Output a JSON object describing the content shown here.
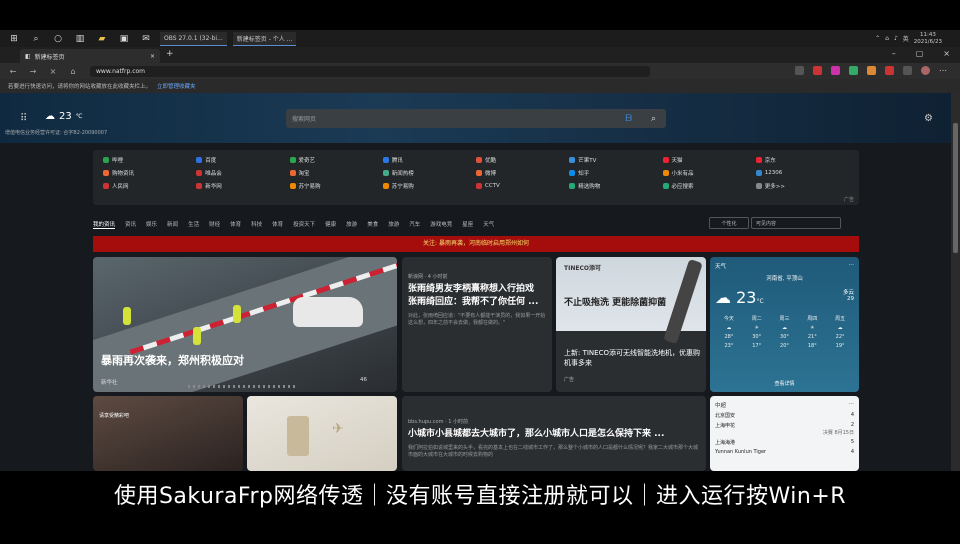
{
  "taskbar": {
    "obs_app": "OBS 27.0.1 (32-bi...",
    "edge_app": "新建标签页 - 个人 ...",
    "lang": "英",
    "time": "11:43",
    "date": "2021/6/23"
  },
  "browser": {
    "tab_title": "新建标签页",
    "url": "www.natfrp.com",
    "infobar_text": "若要进行快速访问，请将你的网站收藏放在此收藏夹栏上。",
    "infobar_link": "立即管理收藏夹"
  },
  "page": {
    "temp": "23",
    "temp_unit": "℃",
    "icp": "增值电信业务经营许可证: 合字B2-20090007",
    "search_placeholder": "搜索网页",
    "links": [
      "哔哩",
      "百度",
      "爱奇艺",
      "腾讯",
      "优酷",
      "芒果TV",
      "天猫",
      "京东",
      "购物资讯",
      "唯品会",
      "淘宝",
      "新闻热榜",
      "微博",
      "知乎",
      "小米有品",
      "12306",
      "人民网",
      "新华网",
      "苏宁易购",
      "苏宁易购",
      "CCTV",
      "精选购物",
      "必应搜索",
      "更多>>"
    ],
    "ad_label": "广告",
    "categories": [
      "我的资讯",
      "资讯",
      "娱乐",
      "新闻",
      "生活",
      "财经",
      "体育",
      "科技",
      "体育",
      "投资天下",
      "健康",
      "旅游",
      "美食",
      "旅游",
      "汽车",
      "游戏电竞",
      "星座",
      "天气"
    ],
    "personalize": "个性化",
    "layout_select": "可见内容",
    "alert": "关注: 暴雨再袭，河南临时启用郑州如何",
    "main_title": "暴雨再次袭来，郑州积极应对",
    "main_source": "新华社",
    "main_reactions": "46",
    "news2_source": "新浪网 · 4 小时前",
    "news2_title": "张雨绮男友李柄熹称想入行拍戏 张雨绮回应：我帮不了你任何 ...",
    "news2_body": "对此，张雨绮回应道：\"不要有人都能干演员的，我如果一开始这么想，四年之前不会去做，我都在做的。\"",
    "ad_logo": "TINECO添可",
    "ad_headline": "不止吸拖洗 更能除菌抑菌",
    "ad_sub": "上新: TINECO添可无线智能洗地机，优惠购机事多来",
    "ad_tag": "广告",
    "weather_title": "天气",
    "weather_loc": "河南省, 平顶山",
    "weather_temp": "23",
    "weather_unit": "°C",
    "weather_cond": "多云",
    "weather_humidity": "29",
    "weather_days": [
      "今天",
      "周二",
      "周三",
      "周四",
      "周五"
    ],
    "weather_highs": [
      "28°",
      "30°",
      "30°",
      "21°",
      "22°"
    ],
    "weather_lows": [
      "23°",
      "17°",
      "20°",
      "18°",
      "19°"
    ],
    "weather_more": "查看详情",
    "img3_caption": "请享受精彩吧",
    "news3_source": "bbs.hupu.com · 1 小时前",
    "news3_title": "小城市小县城都去大城市了，那么小城市人口是怎么保持下来 ...",
    "news3_body": "我们阿拉伯如说城里来的头手，看完的基本上也在二线城市工作了，那么整个小城市的人口是都什么情况呢？我家二大城市那个大城市面的大城市在大城市的时候去购物的",
    "sports_title": "中超",
    "sports_teams": [
      {
        "name": "北京国安",
        "score": "4"
      },
      {
        "name": "上海申花",
        "score": "2"
      },
      {
        "name": "上海海港",
        "score": "5"
      },
      {
        "name": "Yunnan Kunlun Tiger",
        "score": "4"
      }
    ],
    "sports_note": "决赛 8月15日"
  },
  "caption": "使用SakuraFrp网络传透｜没有账号直接注册就可以｜进入运行按Win+R"
}
